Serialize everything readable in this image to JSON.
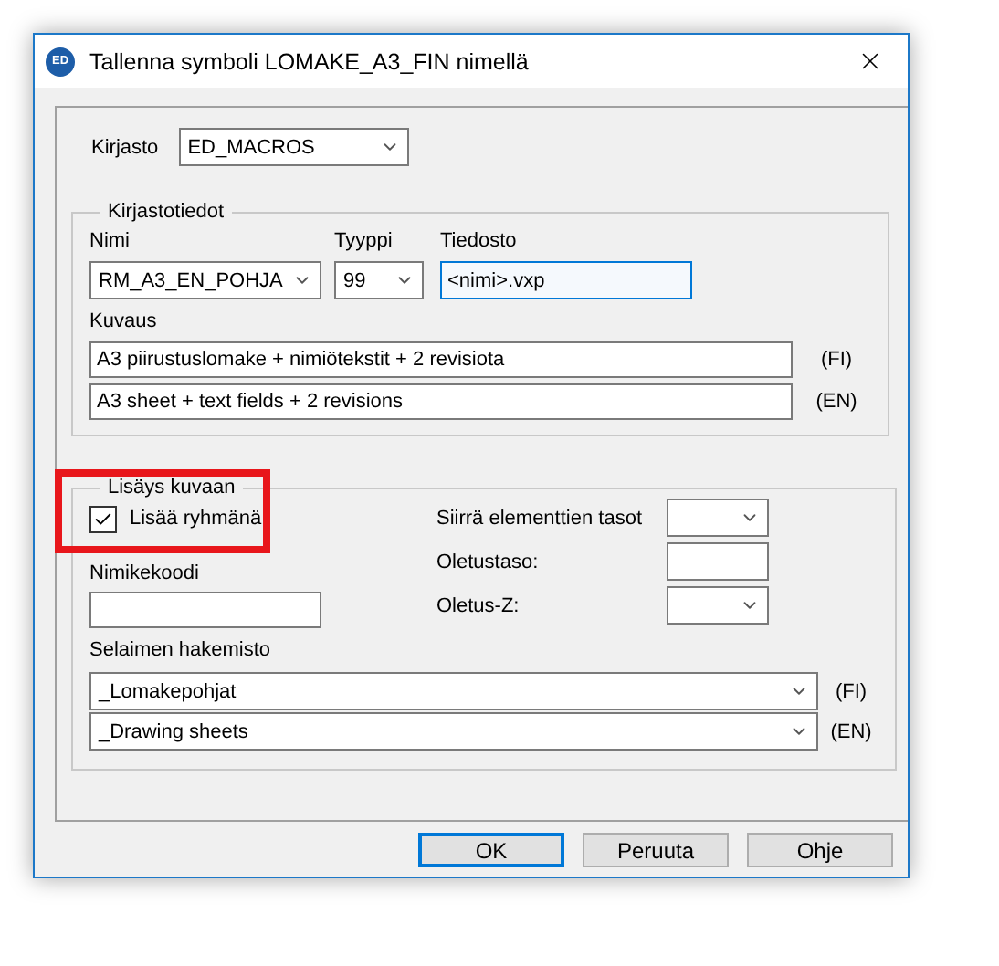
{
  "window": {
    "title": "Tallenna symboli LOMAKE_A3_FIN nimellä",
    "icon_label": "ED"
  },
  "library": {
    "label": "Kirjasto",
    "value": "ED_MACROS"
  },
  "library_info": {
    "legend": "Kirjastotiedot",
    "name": {
      "label": "Nimi",
      "value": "RM_A3_EN_POHJA"
    },
    "type": {
      "label": "Tyyppi",
      "value": "99"
    },
    "file": {
      "label": "Tiedosto",
      "value": "<nimi>.vxp",
      "focused": true
    },
    "description": {
      "label": "Kuvaus",
      "rows": [
        {
          "value": "A3 piirustuslomake + nimiötekstit + 2 revisiota",
          "lang": "(FI)"
        },
        {
          "value": "A3 sheet + text fields + 2 revisions",
          "lang": "(EN)"
        }
      ]
    }
  },
  "insert": {
    "legend": "Lisäys kuvaan",
    "highlighted": true,
    "add_as_group": {
      "label": "Lisää ryhmänä",
      "checked": true
    },
    "item_code": {
      "label": "Nimikekoodi"
    },
    "settings": [
      {
        "label": "Siirrä elementtien tasot",
        "kind": "combo"
      },
      {
        "label": "Oletustaso:",
        "kind": "text"
      },
      {
        "label": "Oletus-Z:",
        "kind": "combo"
      }
    ],
    "browser_dir": {
      "label": "Selaimen hakemisto",
      "rows": [
        {
          "value": "_Lomakepohjat",
          "lang": "(FI)"
        },
        {
          "value": "_Drawing sheets",
          "lang": "(EN)"
        }
      ]
    }
  },
  "buttons": [
    {
      "label": "OK",
      "default": true
    },
    {
      "label": "Peruuta",
      "default": false
    },
    {
      "label": "Ohje",
      "default": false
    }
  ]
}
